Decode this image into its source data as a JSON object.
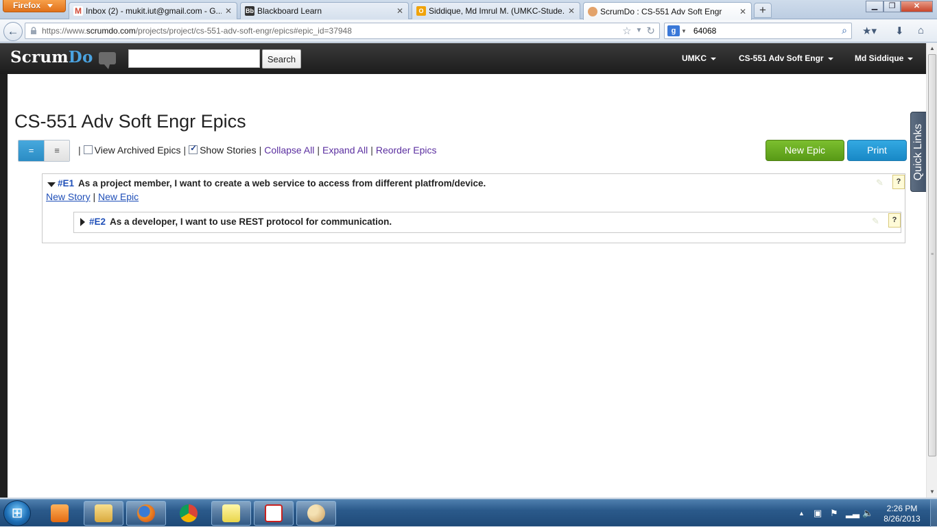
{
  "browser": {
    "menu_button": "Firefox",
    "tabs": [
      {
        "title": "Inbox (2) - mukit.iut@gmail.com - G...",
        "icon": "gmail-icon",
        "active": false
      },
      {
        "title": "Blackboard Learn",
        "icon": "blackboard-icon",
        "active": false
      },
      {
        "title": "Siddique, Md Imrul M. (UMKC-Stude...",
        "icon": "outlook-icon",
        "active": false
      },
      {
        "title": "ScrumDo : CS-551 Adv Soft Engr",
        "icon": "scrumdo-icon",
        "active": true
      }
    ],
    "url_prefix": "https://www.",
    "url_host": "scrumdo.com",
    "url_path": "/projects/project/cs-551-adv-soft-engr/epics#epic_id=37948",
    "search_value": "64068",
    "search_engine_letter": "g"
  },
  "header": {
    "logo_part1": "Scrum",
    "logo_part2": "Do",
    "search_button": "Search",
    "menus": [
      "UMKC",
      "CS-551 Adv Soft Engr",
      "Md Siddique"
    ]
  },
  "page": {
    "title": "CS-551 Adv Soft Engr Epics",
    "toggle_list_glyph": "=",
    "toggle_tree_glyph": "≡",
    "view_archived_label": "View Archived Epics",
    "view_archived_checked": false,
    "show_stories_label": "Show Stories",
    "show_stories_checked": true,
    "collapse_all": "Collapse All",
    "expand_all": "Expand All",
    "reorder_epics": "Reorder Epics",
    "new_epic_button": "New Epic",
    "print_button": "Print",
    "quick_links": "Quick Links",
    "separator": "|"
  },
  "epics": [
    {
      "id": "#E1",
      "text": "As a project member, I want to create a web service to access from different platfrom/device.",
      "expanded": true,
      "links": {
        "new_story": "New Story",
        "new_epic": "New Epic"
      },
      "help": "?"
    },
    {
      "id": "#E2",
      "text": "As a developer, I want to use REST protocol for communication.",
      "expanded": false,
      "help": "?"
    }
  ],
  "taskbar": {
    "time": "2:26 PM",
    "date": "8/26/2013",
    "apps": [
      "media-player-icon",
      "explorer-icon",
      "firefox-icon",
      "chrome-icon",
      "sticky-notes-icon",
      "acrobat-icon",
      "paint-icon"
    ]
  },
  "colors": {
    "accent_blue": "#2b8cc4",
    "new_epic_green": "#589a16",
    "header_dark": "#1c1c1c",
    "link_purple": "#5b2fa0"
  }
}
